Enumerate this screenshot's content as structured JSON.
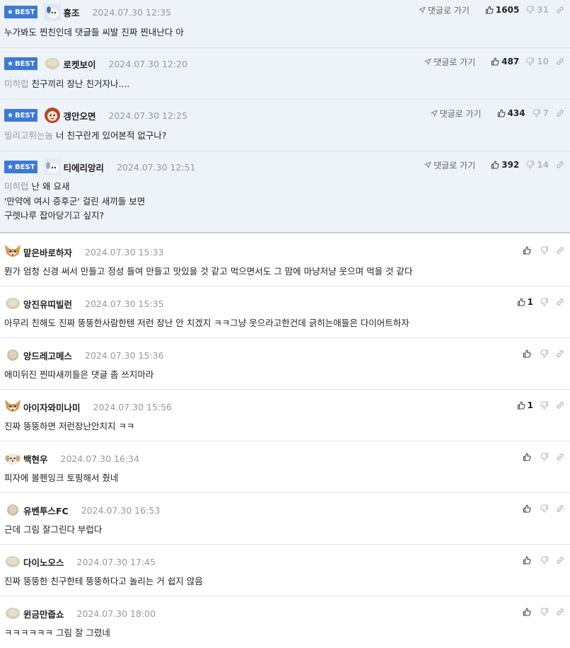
{
  "labels": {
    "best_badge": "BEST",
    "goto_label": "댓글로 가기"
  },
  "best_comments": [
    {
      "nick": "흉조",
      "date": "2024.07.30 12:35",
      "mention": "",
      "lines": [
        "누가봐도 찐친인데 댓글들 씨발 진짜 찐내난다 아"
      ],
      "likes": "1605",
      "dislikes": "31",
      "avatar": "dog-icon"
    },
    {
      "nick": "로켓보이",
      "date": "2024.07.30 12:20",
      "mention": "미히럽",
      "lines": [
        "친구끼리 장난 친거자나...."
      ],
      "likes": "487",
      "dislikes": "10",
      "avatar": "level-icon"
    },
    {
      "nick": "갱안오면",
      "date": "2024.07.30 12:25",
      "mention": "빌리고튀는놈",
      "lines": [
        "너 친구란게 있어본적 없구나?"
      ],
      "likes": "434",
      "dislikes": "7",
      "avatar": "dog-icon"
    },
    {
      "nick": "티에리앙리",
      "date": "2024.07.30 12:51",
      "mention": "미히럽",
      "lines": [
        "난 왜 요새",
        "'만약에 여시 증후군' 걸린 새끼들 보면",
        "구렛나루 잡아당기고 싶지?"
      ],
      "likes": "392",
      "dislikes": "14",
      "avatar": "dog-icon"
    }
  ],
  "comments": [
    {
      "nick": "맡은바로하자",
      "date": "2024.07.30 15:33",
      "text": "뭔가 엄청 신경 써서 만들고 정성 들여 만들고 맛있을 것 같고 먹으면서도 그 맘에 마냥저냥 웃으며 먹을 것 같다",
      "likes": "",
      "avatar": "fox-icon"
    },
    {
      "nick": "앙진유띠빌런",
      "date": "2024.07.30 15:35",
      "text": "아무리 친해도 진짜 뚱뚱한사람한텐 저런 장난 안 치겠지 ㅋㅋ그냥 웃으라고한건데 긁히는애들은 다이어트하자",
      "likes": "1",
      "avatar": "level-icon"
    },
    {
      "nick": "앙드레고메스",
      "date": "2024.07.30 15:36",
      "text": "애미뒤진 찐따새끼들은 댓글 좀 쓰지마라",
      "likes": "",
      "avatar": "level-icon"
    },
    {
      "nick": "아이자와미나미",
      "date": "2024.07.30 15:56",
      "text": "진짜 뚱뚱하면 저런장난안치지 ㅋㅋ",
      "likes": "1",
      "avatar": "fox-icon"
    },
    {
      "nick": "백현우",
      "date": "2024.07.30 16:34",
      "text": "피자에 볼펜잉크 토핑해서 줬네",
      "likes": "",
      "avatar": "dog-icon"
    },
    {
      "nick": "유벤투스FC",
      "date": "2024.07.30 16:53",
      "text": "근데 그림 잘그린다 부럽다",
      "likes": "",
      "avatar": "level-icon"
    },
    {
      "nick": "다이노오스",
      "date": "2024.07.30 17:45",
      "text": "진짜 뚱뚱한 친구한테 뚱뚱하다고 놀리는 거 쉽지 않음",
      "likes": "",
      "avatar": "level-icon"
    },
    {
      "nick": "윈금만줍쇼",
      "date": "2024.07.30 18:00",
      "text": "ㅋㅋㅋㅋㅋㅋ 그림 잘 그렸네",
      "likes": "",
      "avatar": "level-icon"
    }
  ],
  "colors": {
    "best_bg": "#eef2f9",
    "badge": "#3d79d6",
    "divider": "#dde3ec"
  }
}
